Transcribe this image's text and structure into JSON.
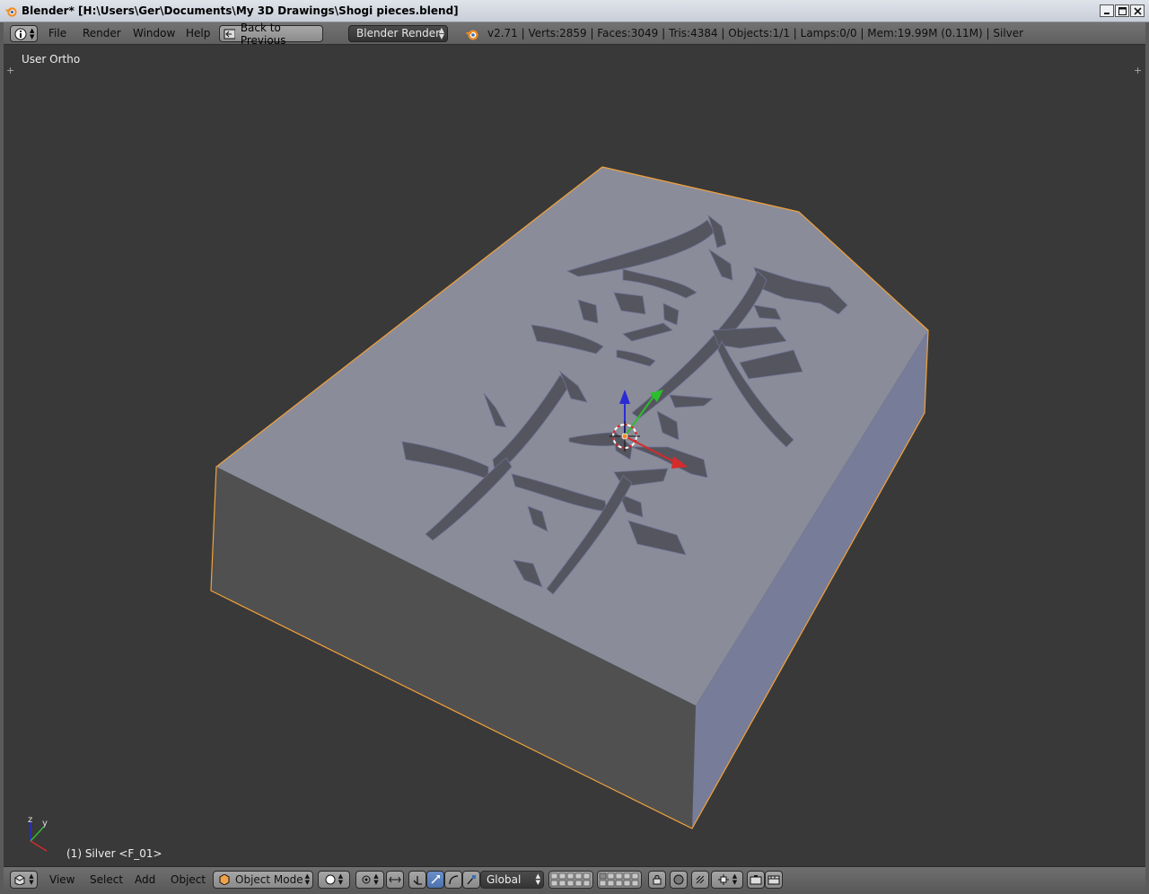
{
  "window": {
    "title": "Blender* [H:\\Users\\Ger\\Documents\\My 3D Drawings\\Shogi pieces.blend]"
  },
  "header": {
    "editor_type_icon": "info-icon",
    "menus": [
      "File",
      "Render",
      "Window",
      "Help"
    ],
    "back_button_label": "Back to Previous",
    "render_engine": "Blender Render",
    "stats": "v2.71 | Verts:2859 | Faces:3049 | Tris:4384 | Objects:1/1 | Lamps:0/0 | Mem:19.99M (0.11M) | Silver"
  },
  "viewport": {
    "view_label": "User Ortho",
    "object_label": "(1) Silver <F_01>",
    "axis_labels": {
      "z": "z",
      "y": "y"
    },
    "colors": {
      "background": "#393939",
      "top_face": "#8a8c9a",
      "front_face": "#505050",
      "right_face": "#797e99",
      "selection_outline": "#f2a23a",
      "engraving": "#55555f"
    }
  },
  "footer": {
    "menus": [
      "View",
      "Select",
      "Add",
      "Object"
    ],
    "mode": "Object Mode",
    "orientation": "Global",
    "icons": [
      "view3d-editor-icon",
      "shading-solid-icon",
      "pivot-point-icon",
      "manipulator-toggle-icon",
      "translate-manipulator-icon",
      "rotate-manipulator-icon",
      "scale-manipulator-icon",
      "layer-grid-icon",
      "layer-grid-2-icon",
      "lock-layers-icon",
      "render-preview-icon",
      "snap-icon",
      "snap-target-icon",
      "opengl-render-icon",
      "opengl-anim-icon"
    ]
  }
}
